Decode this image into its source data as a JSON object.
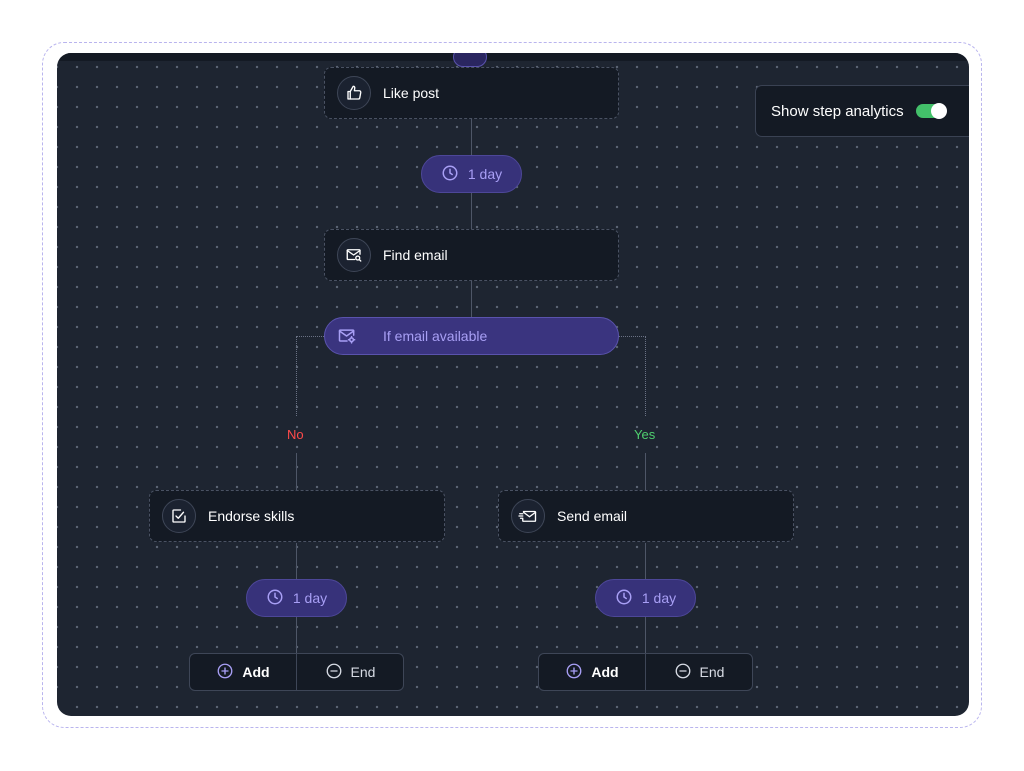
{
  "settings": {
    "analytics_label": "Show step analytics",
    "analytics_on": true
  },
  "flow": {
    "like_post": "Like post",
    "delay_1": "1 day",
    "find_email": "Find email",
    "condition": "If email available",
    "branch_no": "No",
    "branch_yes": "Yes",
    "endorse_skills": "Endorse skills",
    "send_email": "Send email",
    "delay_left": "1 day",
    "delay_right": "1 day",
    "add_label": "Add",
    "end_label": "End"
  },
  "colors": {
    "canvas": "#1e2531",
    "node": "#141a24",
    "accent": "#a89ff5",
    "no": "#ff4a4a",
    "yes": "#4fd06f",
    "toggle": "#43c06a"
  },
  "icons": {
    "like": "thumbs-up-icon",
    "find_email": "mail-search-icon",
    "condition": "mail-settings-icon",
    "endorse": "check-square-icon",
    "send_email": "send-mail-icon",
    "clock": "clock-icon",
    "add": "plus-circle-icon",
    "end": "minus-circle-icon"
  }
}
